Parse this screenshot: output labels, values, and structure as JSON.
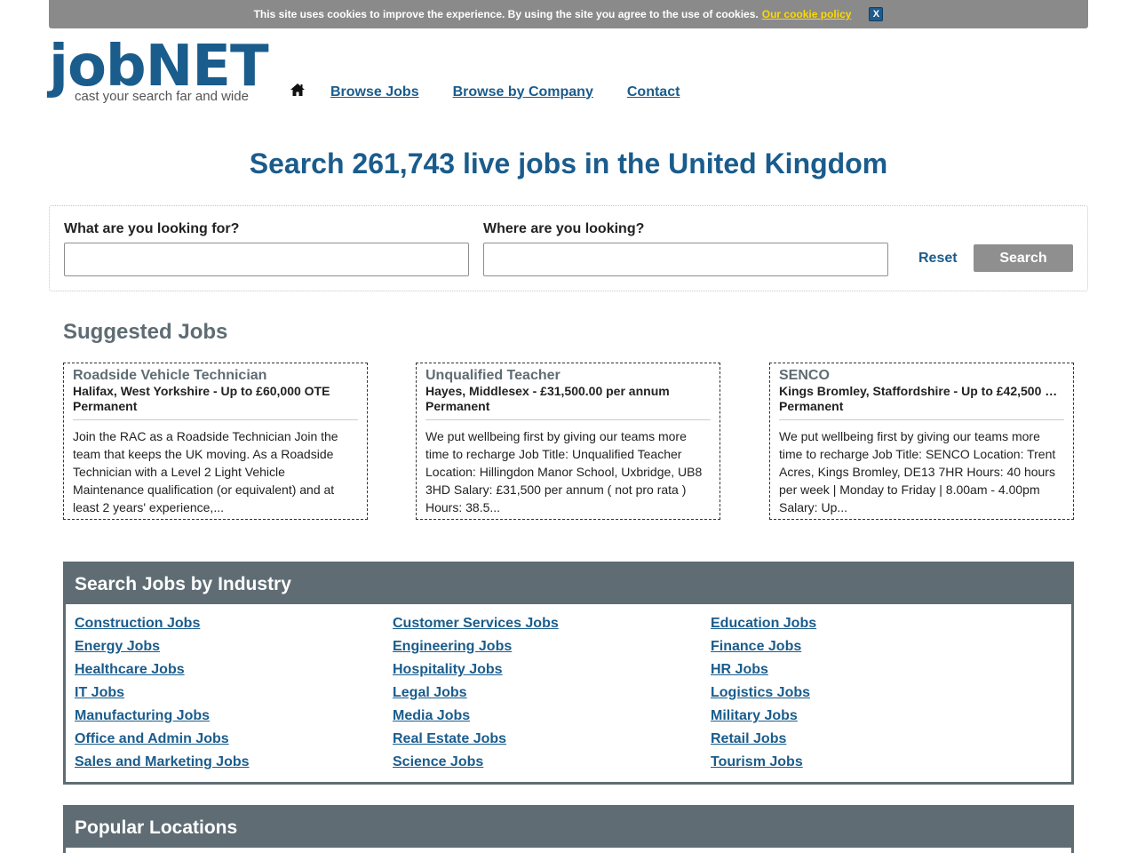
{
  "cookie": {
    "message": "This site uses cookies to improve the experience. By using the site you agree to the use of cookies.",
    "policy_link": "Our cookie policy",
    "close_label": "X"
  },
  "header": {
    "brand": "jobNET",
    "tagline": "cast your search far and wide",
    "nav": [
      "Browse Jobs",
      "Browse by Company",
      "Contact"
    ],
    "icons": {
      "home": "home-icon"
    }
  },
  "headline": "Search 261,743 live jobs in the United Kingdom",
  "search": {
    "what_label": "What are you looking for?",
    "what_value": "",
    "where_label": "Where are you looking?",
    "where_value": "",
    "reset_label": "Reset",
    "search_label": "Search"
  },
  "suggested": {
    "title": "Suggested Jobs",
    "jobs": [
      {
        "title": "Roadside Vehicle Technician",
        "location_salary": "Halifax, West Yorkshire - Up to £60,000 OTE",
        "type": "Permanent",
        "description": "Join the RAC as a Roadside Technician Join the team that keeps the UK moving. As a Roadside Technician with a Level 2 Light Vehicle Maintenance qualification (or equivalent) and at least 2 years' experience,..."
      },
      {
        "title": "Unqualified Teacher",
        "location_salary": "Hayes, Middlesex - £31,500.00 per annum",
        "type": "Permanent",
        "description": "We put wellbeing first by giving our teams more time to recharge Job Title: Unqualified Teacher Location: Hillingdon Manor School, Uxbridge, UB8 3HD Salary: £31,500 per annum ( not pro rata ) Hours: 38.5..."
      },
      {
        "title": "SENCO",
        "location_salary": "Kings Bromley, Staffordshire - Up to £42,500 …",
        "type": "Permanent",
        "description": "We put wellbeing first by giving our teams more time to recharge Job Title: SENCO Location: Trent Acres, Kings Bromley, DE13 7HR Hours: 40 hours per week | Monday to Friday | 8.00am - 4.00pm Salary: Up..."
      }
    ]
  },
  "industries": {
    "title": "Search Jobs by Industry",
    "items": [
      "Construction Jobs",
      "Customer Services Jobs",
      "Education Jobs",
      "Energy Jobs",
      "Engineering Jobs",
      "Finance Jobs",
      "Healthcare Jobs",
      "Hospitality Jobs",
      "HR Jobs",
      "IT Jobs",
      "Legal Jobs",
      "Logistics Jobs",
      "Manufacturing Jobs",
      "Media Jobs",
      "Military Jobs",
      "Office and Admin Jobs",
      "Real Estate Jobs",
      "Retail Jobs",
      "Sales and Marketing Jobs",
      "Science Jobs",
      "Tourism Jobs"
    ]
  },
  "locations": {
    "title": "Popular Locations"
  },
  "colors": {
    "brand_blue": "#1a5c8c",
    "section_grey": "#5f6c74",
    "cookie_bar": "#8a8a8a",
    "cookie_link": "#ffd800"
  }
}
